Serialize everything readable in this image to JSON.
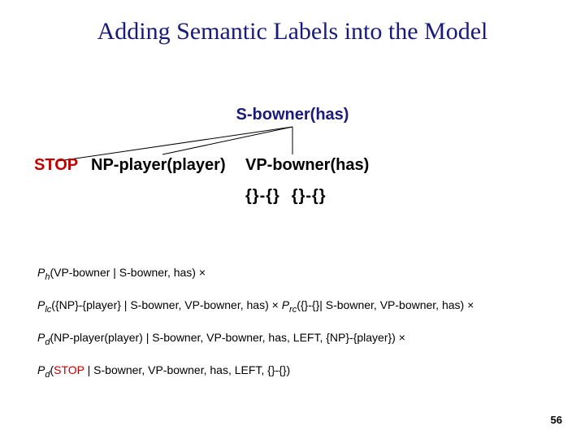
{
  "title": "Adding Semantic Labels into the Model",
  "tree": {
    "root": "S-bowner(has)",
    "stop": "STOP",
    "np": "NP-player(player)",
    "vp": "VP-bowner(has)",
    "braces_left": "{}-{}",
    "braces_right": "{}-{}"
  },
  "formulas": {
    "line1_pre": "P",
    "line1_sub": "h",
    "line1_body": "(VP-bowner | S-bowner, has) ×",
    "line2a_pre": "P",
    "line2a_sub": "lc",
    "line2a_body": "({NP}-{player} | S-bowner, VP-bowner, has) × ",
    "line2b_pre": "P",
    "line2b_sub": "rc",
    "line2b_body": "({}-{}| S-bowner, VP-bowner, has) ×",
    "line3_pre": "P",
    "line3_sub": "d",
    "line3_body": "(NP-player(player) | S-bowner, VP-bowner, has, LEFT, {NP}-{player}) ×",
    "line4_pre": "P",
    "line4_sub": "d",
    "line4_body_open": "(",
    "line4_stop": "STOP",
    "line4_body_rest": " | S-bowner, VP-bowner, has, LEFT, {}-{})"
  },
  "pagenum": "56"
}
